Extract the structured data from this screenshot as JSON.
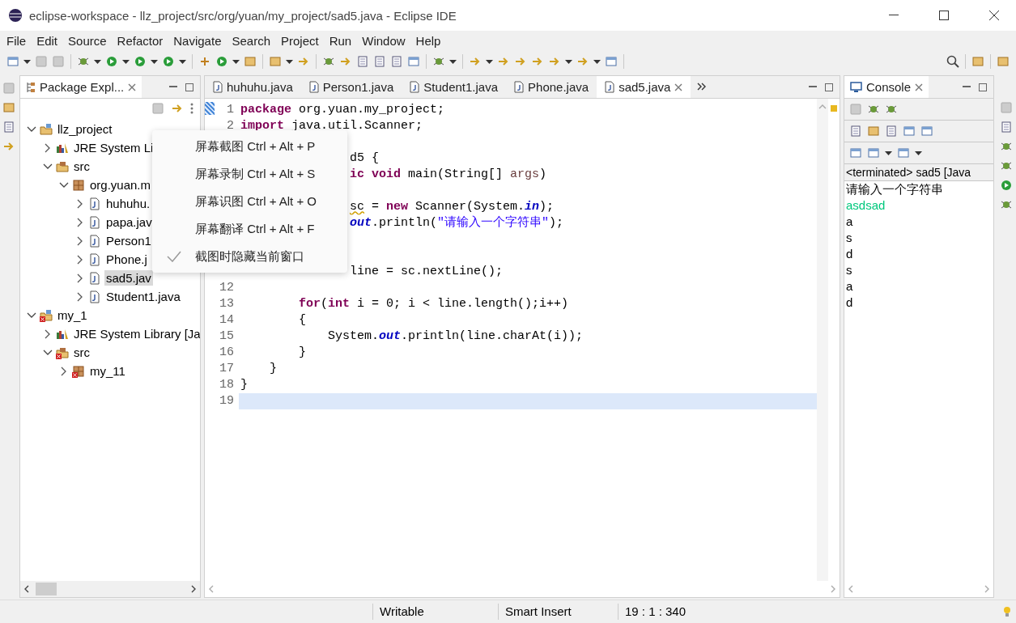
{
  "window": {
    "title": "eclipse-workspace - llz_project/src/org/yuan/my_project/sad5.java - Eclipse IDE"
  },
  "menu": [
    "File",
    "Edit",
    "Source",
    "Refactor",
    "Navigate",
    "Search",
    "Project",
    "Run",
    "Window",
    "Help"
  ],
  "package_explorer": {
    "title": "Package Expl...",
    "tree": [
      {
        "label": "llz_project",
        "kind": "project",
        "error": false,
        "expanded": true,
        "selected": false,
        "children": [
          {
            "label": "JRE System Li",
            "kind": "library",
            "error": false,
            "expanded": false,
            "selected": false
          },
          {
            "label": "src",
            "kind": "folder",
            "error": false,
            "expanded": true,
            "selected": false,
            "children": [
              {
                "label": "org.yuan.m",
                "kind": "package",
                "error": false,
                "expanded": true,
                "selected": false,
                "children": [
                  {
                    "label": "huhuhu.",
                    "kind": "java",
                    "error": false,
                    "expanded": false,
                    "selected": false
                  },
                  {
                    "label": "papa.jav",
                    "kind": "java",
                    "error": false,
                    "expanded": false,
                    "selected": false
                  },
                  {
                    "label": "Person1",
                    "kind": "java",
                    "error": false,
                    "expanded": false,
                    "selected": false
                  },
                  {
                    "label": "Phone.j",
                    "kind": "java",
                    "error": false,
                    "expanded": false,
                    "selected": false
                  },
                  {
                    "label": "sad5.jav",
                    "kind": "java",
                    "error": false,
                    "expanded": false,
                    "selected": true
                  },
                  {
                    "label": "Student1.java",
                    "kind": "java",
                    "error": false,
                    "expanded": false,
                    "selected": false
                  }
                ]
              }
            ]
          }
        ]
      },
      {
        "label": "my_1",
        "kind": "project",
        "error": true,
        "expanded": true,
        "selected": false,
        "children": [
          {
            "label": "JRE System Library [Ja",
            "kind": "library",
            "error": false,
            "expanded": false,
            "selected": false
          },
          {
            "label": "src",
            "kind": "folder",
            "error": true,
            "expanded": true,
            "selected": false,
            "children": [
              {
                "label": "my_11",
                "kind": "package",
                "error": true,
                "expanded": false,
                "selected": false
              }
            ]
          }
        ]
      }
    ]
  },
  "editor": {
    "tabs": [
      {
        "label": "huhuhu.java",
        "selected": false
      },
      {
        "label": "Person1.java",
        "selected": false
      },
      {
        "label": "Student1.java",
        "selected": false
      },
      {
        "label": "Phone.java",
        "selected": false
      },
      {
        "label": "sad5.java",
        "selected": true
      }
    ],
    "lines": [
      {
        "number": "1",
        "covered": false,
        "current": false,
        "tokens": [
          {
            "kind": "keyword",
            "text": "package"
          },
          {
            "kind": "plain",
            "text": " org.yuan.my_project;"
          }
        ]
      },
      {
        "number": "2",
        "covered": false,
        "current": false,
        "tokens": [
          {
            "kind": "keyword",
            "text": "import"
          },
          {
            "kind": "plain",
            "text": " java.util.Scanner;"
          }
        ]
      },
      {
        "current": false
      },
      {
        "covered": true,
        "current": false,
        "tokens": [
          {
            "kind": "plain",
            "text": "d5 {"
          }
        ]
      },
      {
        "covered": true,
        "current": false,
        "tokens": [
          {
            "kind": "keyword",
            "text": "ic void"
          },
          {
            "kind": "plain",
            "text": " main(String[] "
          },
          {
            "kind": "param",
            "text": "args"
          },
          {
            "kind": "plain",
            "text": ")"
          }
        ]
      },
      {
        "current": false
      },
      {
        "covered": true,
        "current": false,
        "tokens": [
          {
            "kind": "warning",
            "text": "sc"
          },
          {
            "kind": "plain",
            "text": " = "
          },
          {
            "kind": "keyword",
            "text": "new"
          },
          {
            "kind": "plain",
            "text": " Scanner(System."
          },
          {
            "kind": "field",
            "text": "in"
          },
          {
            "kind": "plain",
            "text": ");"
          }
        ]
      },
      {
        "covered": true,
        "current": false,
        "tokens": [
          {
            "kind": "field",
            "text": "out"
          },
          {
            "kind": "plain",
            "text": ".println("
          },
          {
            "kind": "string",
            "text": "\"请输入一个字符串\""
          },
          {
            "kind": "plain",
            "text": ");"
          }
        ]
      },
      {
        "current": false
      },
      {
        "current": false
      },
      {
        "covered": true,
        "current": false,
        "tokens": [
          {
            "kind": "plain",
            "text": "line = sc.nextLine();"
          }
        ]
      },
      {
        "number": "12",
        "current": false
      },
      {
        "number": "13",
        "covered": false,
        "current": false,
        "tokens": [
          {
            "kind": "keyword",
            "text": "        for"
          },
          {
            "kind": "plain",
            "text": "("
          },
          {
            "kind": "keyword",
            "text": "int"
          },
          {
            "kind": "plain",
            "text": " i = 0; i < line.length();i++)"
          }
        ]
      },
      {
        "number": "14",
        "covered": false,
        "current": false,
        "tokens": [
          {
            "kind": "plain",
            "text": "        {"
          }
        ]
      },
      {
        "number": "15",
        "covered": false,
        "current": false,
        "tokens": [
          {
            "kind": "plain",
            "text": "            System."
          },
          {
            "kind": "field",
            "text": "out"
          },
          {
            "kind": "plain",
            "text": ".println(line.charAt(i));"
          }
        ]
      },
      {
        "number": "16",
        "covered": false,
        "current": false,
        "tokens": [
          {
            "kind": "plain",
            "text": "        }"
          }
        ]
      },
      {
        "number": "17",
        "covered": false,
        "current": false,
        "tokens": [
          {
            "kind": "plain",
            "text": "    }"
          }
        ]
      },
      {
        "number": "18",
        "covered": false,
        "current": false,
        "tokens": [
          {
            "kind": "plain",
            "text": "}"
          }
        ]
      },
      {
        "number": "19",
        "current": true
      }
    ]
  },
  "console": {
    "title": "Console",
    "header": "<terminated> sad5 [Java",
    "lines": [
      {
        "kind": "output",
        "text": "请输入一个字符串"
      },
      {
        "kind": "input",
        "text": "asdsad"
      },
      {
        "kind": "output",
        "text": "a"
      },
      {
        "kind": "output",
        "text": "s"
      },
      {
        "kind": "output",
        "text": "d"
      },
      {
        "kind": "output",
        "text": "s"
      },
      {
        "kind": "output",
        "text": "a"
      },
      {
        "kind": "output",
        "text": "d"
      }
    ]
  },
  "context_menu": {
    "items": [
      {
        "label": "屏幕截图 Ctrl + Alt + P",
        "checked": false
      },
      {
        "label": "屏幕录制 Ctrl + Alt + S",
        "checked": false
      },
      {
        "label": "屏幕识图 Ctrl + Alt + O",
        "checked": false
      },
      {
        "label": "屏幕翻译 Ctrl + Alt + F",
        "checked": false
      },
      {
        "label": "截图时隐藏当前窗口",
        "checked": true
      }
    ]
  },
  "status_bar": [
    "Writable",
    "Smart Insert",
    "19 : 1 : 340"
  ]
}
